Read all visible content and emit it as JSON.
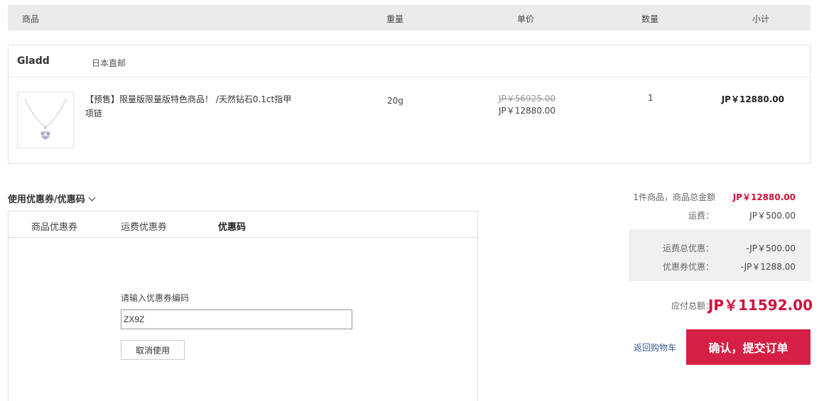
{
  "header": {
    "col_product": "商品",
    "col_weight": "重量",
    "col_unit_price": "单价",
    "col_quantity": "数量",
    "col_subtotal": "小计"
  },
  "shop": {
    "name": "Gladd",
    "tag": "日本直邮"
  },
  "item": {
    "title": "【预售】限量版限量版特色商品！ /天然钻石0.1ct指甲项链",
    "weight": "20g",
    "original_price": "JP￥56925.00",
    "price": "JP￥12880.00",
    "quantity": "1",
    "subtotal": "JP￥12880.00",
    "image_icon": "necklace-pendant-image"
  },
  "coupon": {
    "toggle_label": "使用优惠券/优惠码",
    "tabs": [
      {
        "label": "商品优惠券",
        "active": false
      },
      {
        "label": "运费优惠券",
        "active": false
      },
      {
        "label": "优惠码",
        "active": true
      }
    ],
    "code_label": "请输入优惠券编码",
    "code_value": "ZX9Z",
    "cancel_label": "取消使用"
  },
  "summary": {
    "items_total_label": "1件商品，商品总金额",
    "items_total_value": "JP￥12880.00",
    "shipping_label": "运费：",
    "shipping_value": "JP￥500.00",
    "shipping_discount_label": "运费总优惠：",
    "shipping_discount_value": "-JP￥500.00",
    "coupon_discount_label": "优惠券优惠：",
    "coupon_discount_value": "-JP￥1288.00",
    "payable_label": "应付总额：",
    "payable_value": "JP￥11592.00"
  },
  "actions": {
    "back_label": "返回购物车",
    "submit_label": "确认，提交订单"
  },
  "colors": {
    "accent": "#d61f44",
    "price_red": "#d0103a",
    "link": "#3a5a8c"
  }
}
